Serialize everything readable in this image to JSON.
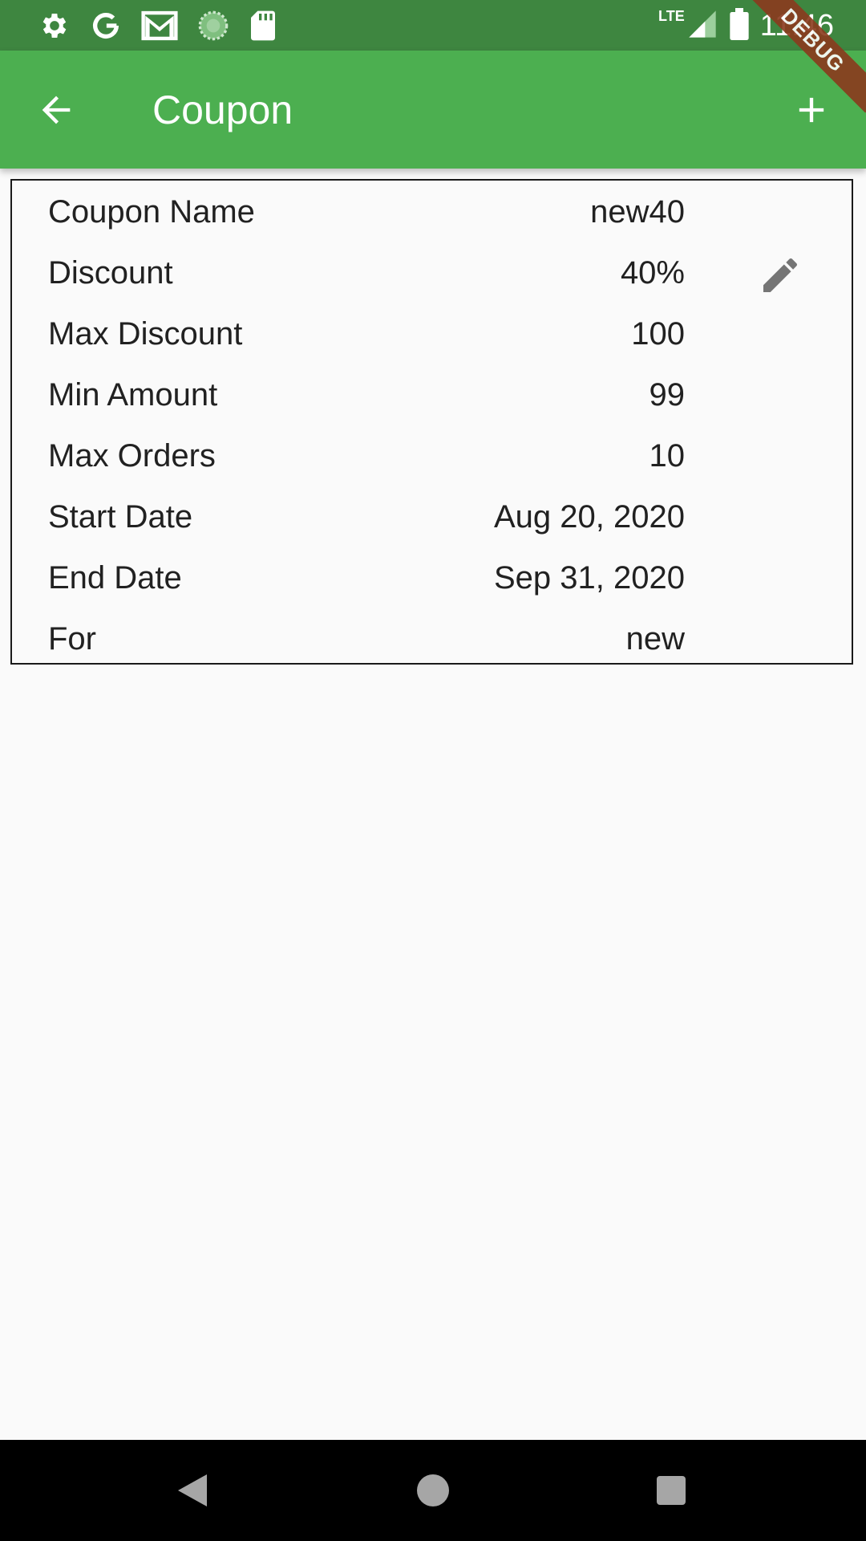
{
  "status_bar": {
    "icons": [
      "settings-icon",
      "google-icon",
      "gmail-icon",
      "sync-icon",
      "sd-card-icon"
    ],
    "network_label": "LTE",
    "time": "11:46"
  },
  "debug_banner": "DEBUG",
  "app_bar": {
    "title": "Coupon",
    "back_icon": "arrow-back-icon",
    "add_icon": "add-icon"
  },
  "coupon": {
    "rows": [
      {
        "label": "Coupon Name",
        "value": "new40"
      },
      {
        "label": "Discount",
        "value": "40%"
      },
      {
        "label": "Max Discount",
        "value": "100"
      },
      {
        "label": "Min Amount",
        "value": "99"
      },
      {
        "label": "Max Orders",
        "value": "10"
      },
      {
        "label": "Start Date",
        "value": "Aug 20, 2020"
      },
      {
        "label": "End Date",
        "value": "Sep 31, 2020"
      },
      {
        "label": "For",
        "value": "new"
      }
    ],
    "edit_icon": "edit-pencil-icon"
  },
  "nav_bar": {
    "icons": [
      "back-triangle-icon",
      "home-circle-icon",
      "recents-square-icon"
    ]
  },
  "colors": {
    "status_bar": "#3e8640",
    "app_bar": "#4caf50",
    "background": "#fafafa",
    "text": "#212121",
    "edit_icon": "#757575"
  }
}
